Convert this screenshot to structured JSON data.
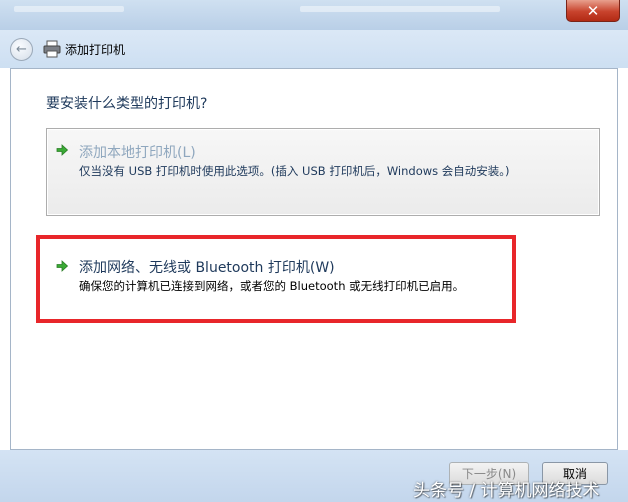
{
  "window": {
    "title": "添加打印机",
    "close_glyph": "✕"
  },
  "main": {
    "question": "要安装什么类型的打印机?",
    "options": [
      {
        "label": "添加本地打印机(L)",
        "description": "仅当没有 USB 打印机时使用此选项。(插入 USB 打印机后，Windows 会自动安装。)",
        "icon": "green-arrow-icon",
        "enabled": false
      },
      {
        "label": "添加网络、无线或 Bluetooth 打印机(W)",
        "description": "确保您的计算机已连接到网络，或者您的 Bluetooth 或无线打印机已启用。",
        "icon": "green-arrow-icon",
        "enabled": true,
        "highlighted": true
      }
    ]
  },
  "footer": {
    "next_label": "下一步(N)",
    "cancel_label": "取消"
  },
  "watermark": "头条号 / 计算机网络技术",
  "colors": {
    "highlight_border": "#e8262a",
    "title_text": "#1e395b",
    "disabled_text": "#8fa7be"
  }
}
